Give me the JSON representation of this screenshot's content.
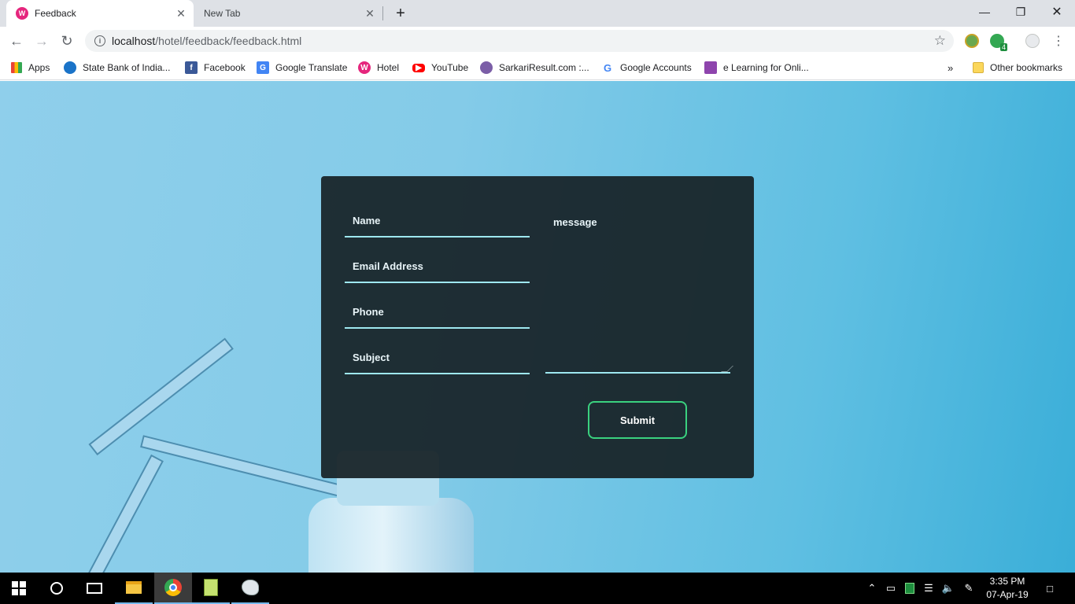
{
  "browser": {
    "tabs": [
      {
        "title": "Feedback",
        "active": true
      },
      {
        "title": "New Tab",
        "active": false
      }
    ],
    "url_host": "localhost",
    "url_path": "/hotel/feedback/feedback.html",
    "bookmarks": [
      {
        "label": "Apps",
        "icon": "apps-grid-icon"
      },
      {
        "label": "State Bank of India...",
        "icon": "sbi-icon"
      },
      {
        "label": "Facebook",
        "icon": "facebook-icon"
      },
      {
        "label": "Google Translate",
        "icon": "google-translate-icon"
      },
      {
        "label": "Hotel",
        "icon": "hotel-icon"
      },
      {
        "label": "YouTube",
        "icon": "youtube-icon"
      },
      {
        "label": "SarkariResult.com :...",
        "icon": "sarkariresult-icon"
      },
      {
        "label": "Google Accounts",
        "icon": "google-icon"
      },
      {
        "label": "e Learning for Onli...",
        "icon": "elearning-icon"
      }
    ],
    "overflow_label": "»",
    "other_bookmarks": "Other bookmarks",
    "extension_badge": "4"
  },
  "form": {
    "name_label": "Name",
    "email_label": "Email Address",
    "phone_label": "Phone",
    "subject_label": "Subject",
    "message_label": "message",
    "submit_label": "Submit"
  },
  "taskbar": {
    "time": "3:35 PM",
    "date": "07-Apr-19"
  },
  "colors": {
    "accent_green": "#3ad17f",
    "field_underline": "#9ee8f0",
    "card_bg": "#172126"
  }
}
